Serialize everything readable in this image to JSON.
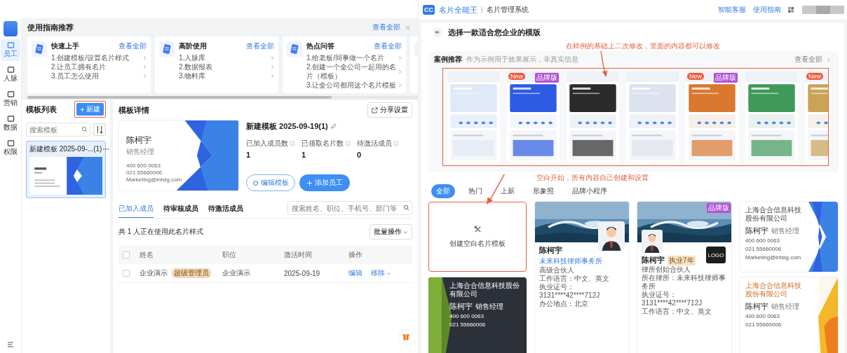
{
  "left": {
    "sidebar": {
      "items": [
        {
          "label": "员工",
          "selected": true
        },
        {
          "label": "人脉",
          "selected": false
        },
        {
          "label": "营销",
          "selected": false
        },
        {
          "label": "数据",
          "selected": false
        },
        {
          "label": "权限",
          "selected": false
        }
      ]
    },
    "guide": {
      "title": "使用指南推荐",
      "view_all": "查看全部",
      "cards": [
        {
          "title": "快速上手",
          "link": "查看全部",
          "items": [
            "1.创建模板/设置名片样式",
            "2.让员工拥有名片",
            "3.员工怎么使用"
          ]
        },
        {
          "title": "高阶使用",
          "link": "查看全部",
          "items": [
            "1.人脉库",
            "2.数据报表",
            "3.物料库"
          ]
        },
        {
          "title": "热点问答",
          "link": "查看全部",
          "items": [
            "1.给老板/同事做一个名片",
            "2.创建一个全公司一起用的名片（模板）",
            "3.让全公司都用这个名片模板"
          ]
        }
      ]
    },
    "template_list": {
      "title": "模板列表",
      "new_button": "新建",
      "search_placeholder": "搜索模板",
      "items": [
        {
          "name": "新建模板 2025-09-...(1)",
          "selected": true
        }
      ]
    },
    "detail": {
      "title": "模板详情",
      "share_button": "分享设置",
      "card": {
        "name": "陈柯宇",
        "role": "销售经理",
        "lines": [
          "400 600 0063",
          "021 55660006",
          "Marketing@intsig.com"
        ]
      },
      "template_name": "新建模板 2025-09-19(1)",
      "stats": [
        {
          "label": "已加入成员数",
          "value": "1"
        },
        {
          "label": "已领取名片数",
          "value": "1"
        },
        {
          "label": "待激活成员",
          "value": "0"
        }
      ],
      "edit_button": "编辑模板",
      "add_button": "添加员工"
    },
    "members": {
      "tabs": [
        {
          "label": "已加入成员",
          "selected": true
        },
        {
          "label": "待审核成员",
          "selected": false
        },
        {
          "label": "待激活成员",
          "selected": false
        }
      ],
      "search_placeholder": "搜索姓名、职位、手机号、部门等",
      "summary": "共 1 人正在使用此名片样式",
      "batch_button": "批量操作",
      "select_all_checked": false,
      "columns": [
        "姓名",
        "职位",
        "激活时间",
        "操作"
      ],
      "rows": [
        {
          "checked": false,
          "name": "企业演示",
          "badge": "超级管理员",
          "position": "企业演示",
          "time": "2025-09-19",
          "actions": [
            "编辑",
            "移除"
          ]
        }
      ]
    }
  },
  "right": {
    "header": {
      "logo": "CC",
      "brand": "名片全能王",
      "system": "名片管理系统",
      "links": [
        "智能客服",
        "使用指南"
      ]
    },
    "title": "选择一款适合您企业的模版",
    "note_top": "在样例的基础上二次修改，里面的内容都可以修改",
    "cases": {
      "title": "案例推荐",
      "subtitle": "作为示例用于效果展示，非真实信息",
      "view_all": "查看全部",
      "previews": [
        {
          "kind": "light"
        },
        {
          "kind": "blue",
          "new_badge": "New",
          "brand_badge": "品牌版"
        },
        {
          "kind": "dark"
        },
        {
          "kind": "portrait"
        },
        {
          "kind": "orange",
          "new_badge": "New",
          "brand_badge": "品牌版"
        },
        {
          "kind": "green"
        },
        {
          "kind": "gold",
          "new_badge": "New"
        }
      ]
    },
    "note_bottom": "空白开始，所有内容自己创建和设置",
    "categories": [
      {
        "label": "全部",
        "selected": true
      },
      {
        "label": "热门",
        "selected": false
      },
      {
        "label": "上新",
        "selected": false
      },
      {
        "label": "形象照",
        "selected": false
      },
      {
        "label": "品牌小程序",
        "selected": false
      }
    ],
    "blank_template": "创建空白名片模板",
    "templates": [
      {
        "kind": "wave",
        "name": "陈柯宇",
        "org": "未来科技律师事务所",
        "role": "高级合伙人",
        "lines": [
          "工作语言：中文、英文",
          "执业证号：3131****42****712J",
          "办公地点：北京"
        ]
      },
      {
        "kind": "wave-brand",
        "brand_badge": "品牌版",
        "name": "陈柯宇",
        "tag": "执业7年",
        "role": "律所创始合伙人",
        "logo": "LOGO",
        "lines": [
          "所在律所：未来科技律师事务所",
          "执业证号：3131****42****712J",
          "工作语言：中文、英文"
        ]
      },
      {
        "kind": "blue",
        "company": "上海合合信息科技股份有限公司",
        "name": "陈柯宇",
        "role": "销售经理",
        "lines": [
          "400 600 0063",
          "021 55660006",
          "Marketing@intsig.com"
        ]
      },
      {
        "kind": "dark",
        "company": "上海合合信息科技股份有限公司",
        "name": "陈柯宇",
        "role": "销售经理",
        "lines": [
          "400 600 0063",
          "021 55660006"
        ]
      },
      {
        "kind": "orange",
        "company": "上海合合信息科技股份有限公司",
        "name": "陈柯宇",
        "role": "销售经理",
        "lines": [
          "400 600 0063",
          "021 55660006"
        ]
      }
    ]
  }
}
